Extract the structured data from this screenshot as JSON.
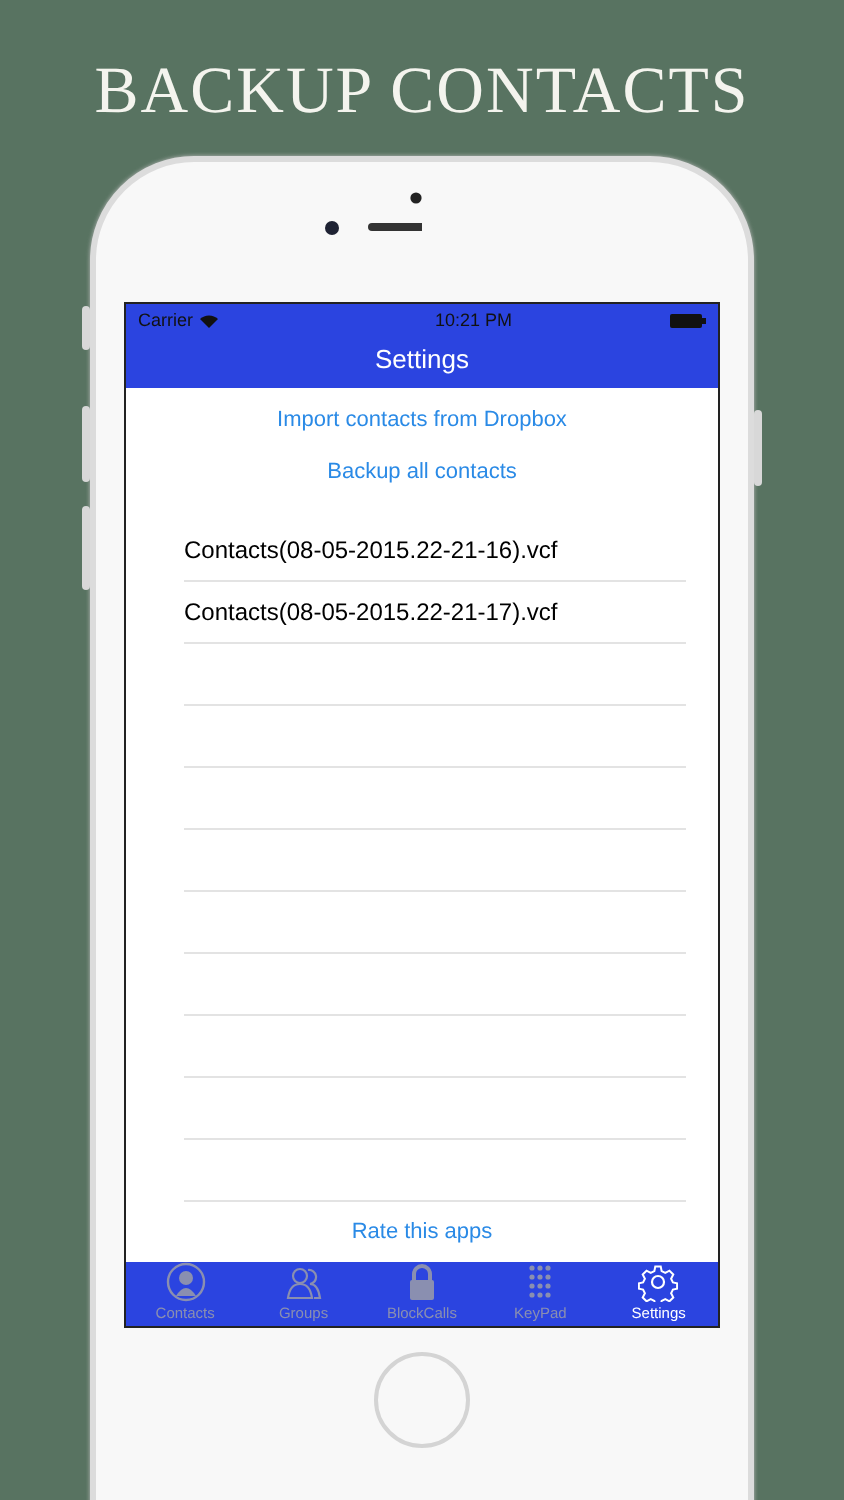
{
  "headline": "BACKUP CONTACTS",
  "status_bar": {
    "carrier": "Carrier",
    "time": "10:21 PM"
  },
  "nav": {
    "title": "Settings"
  },
  "actions": [
    "Import contacts from Dropbox",
    "Backup all contacts"
  ],
  "files": [
    "Contacts(08-05-2015.22-21-16).vcf",
    "Contacts(08-05-2015.22-21-17).vcf"
  ],
  "rate_link": "Rate this apps",
  "tabs": [
    {
      "label": "Contacts",
      "kind": "person",
      "selected": false
    },
    {
      "label": "Groups",
      "kind": "group",
      "selected": false
    },
    {
      "label": "BlockCalls",
      "kind": "lock",
      "selected": false
    },
    {
      "label": "KeyPad",
      "kind": "keypad",
      "selected": false
    },
    {
      "label": "Settings",
      "kind": "gear",
      "selected": true
    }
  ]
}
